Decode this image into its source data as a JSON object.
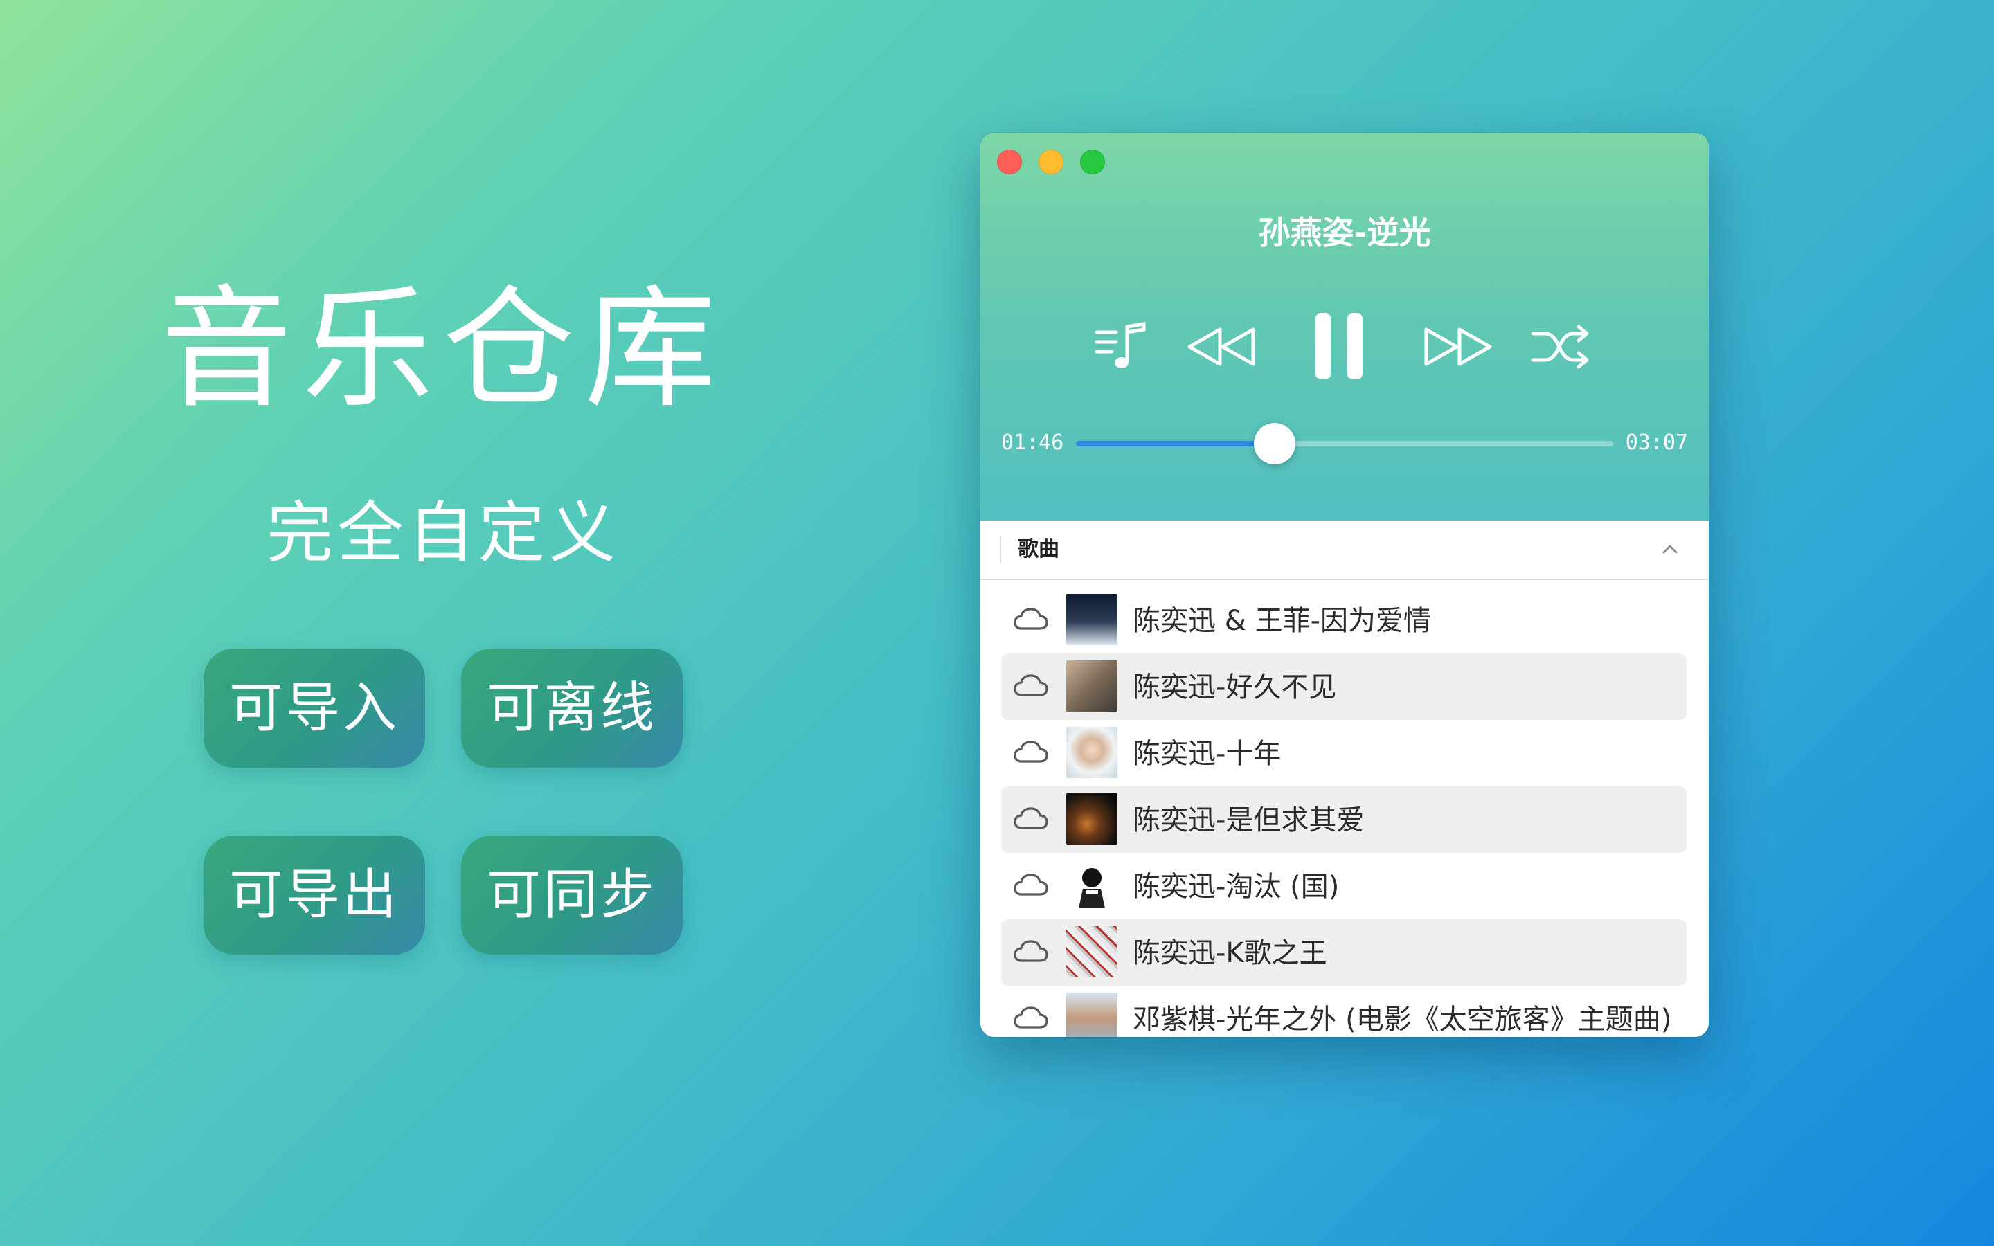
{
  "promo": {
    "title": "音乐仓库",
    "subtitle": "完全自定义",
    "features": [
      "可导入",
      "可离线",
      "可导出",
      "可同步"
    ]
  },
  "player": {
    "song_title": "孙燕姿-逆光",
    "elapsed": "01:46",
    "duration": "03:07",
    "progress_fraction": 0.37,
    "controls": [
      "playlist-icon",
      "rewind-icon",
      "pause-icon",
      "fast-forward-icon",
      "shuffle-icon"
    ],
    "accent_color": "#2a8ae6"
  },
  "list": {
    "header_label": "歌曲",
    "items": [
      {
        "title": "陈奕迅 & 王菲-因为爱情",
        "icon": "cloud-icon"
      },
      {
        "title": "陈奕迅-好久不见",
        "icon": "cloud-icon"
      },
      {
        "title": "陈奕迅-十年",
        "icon": "cloud-icon"
      },
      {
        "title": "陈奕迅-是但求其爱",
        "icon": "cloud-icon"
      },
      {
        "title": "陈奕迅-淘汰 (国)",
        "icon": "cloud-icon"
      },
      {
        "title": "陈奕迅-K歌之王",
        "icon": "cloud-icon"
      },
      {
        "title": "邓紫棋-光年之外 (电影《太空旅客》主题曲)",
        "icon": "cloud-icon"
      }
    ]
  }
}
